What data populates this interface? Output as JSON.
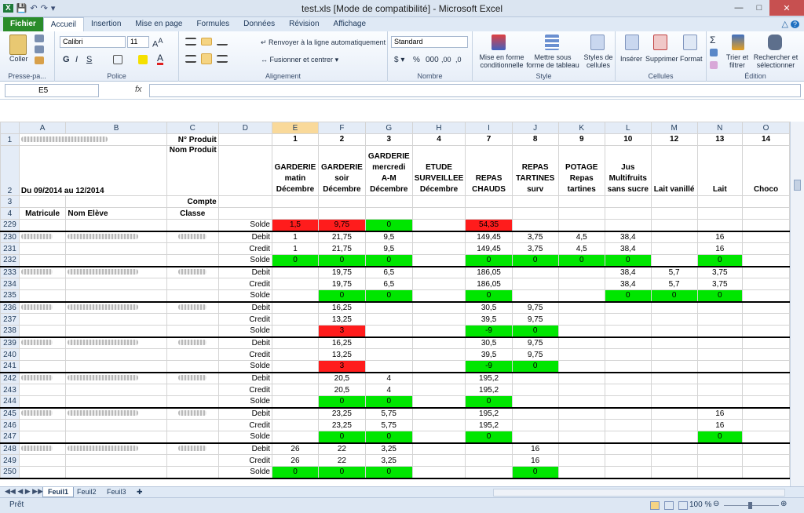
{
  "window": {
    "title": "test.xls  [Mode de compatibilité]  -  Microsoft Excel"
  },
  "tabs": [
    "Fichier",
    "Accueil",
    "Insertion",
    "Mise en page",
    "Formules",
    "Données",
    "Révision",
    "Affichage"
  ],
  "ribbon": {
    "clipboard": {
      "label": "Presse-pa...",
      "paste": "Coller"
    },
    "font": {
      "label": "Police",
      "name": "Calibri",
      "size": "11"
    },
    "alignment": {
      "label": "Alignement",
      "wrap": "Renvoyer à la ligne automatiquement",
      "merge": "Fusionner et centrer"
    },
    "number": {
      "label": "Nombre",
      "format": "Standard"
    },
    "style": {
      "label": "Style",
      "cond": "Mise en forme conditionnelle",
      "table": "Mettre sous forme de tableau",
      "cell": "Styles de cellules"
    },
    "cells": {
      "label": "Cellules",
      "insert": "Insérer",
      "delete": "Supprimer",
      "format": "Format"
    },
    "edit": {
      "label": "Édition",
      "sort": "Trier et filtrer",
      "find": "Rechercher et sélectionner"
    }
  },
  "formula_bar": {
    "name_box": "E5",
    "fx": "fx"
  },
  "columns": [
    "A",
    "B",
    "C",
    "D",
    "E",
    "F",
    "G",
    "H",
    "I",
    "J",
    "K",
    "L",
    "M",
    "N",
    "O"
  ],
  "header_rows": {
    "r1": {
      "c": "N° Produit",
      "nums": [
        "1",
        "2",
        "3",
        "4",
        "7",
        "8",
        "9",
        "10",
        "12",
        "13",
        "14"
      ]
    },
    "r2": {
      "a": "Du 09/2014 au 12/2014",
      "c": "Nom Produit",
      "products": [
        "GARDERIE matin Décembre",
        "GARDERIE soir Décembre",
        "GARDERIE mercredi A-M Décembre",
        "ETUDE SURVEILLEE Décembre",
        "REPAS CHAUDS",
        "REPAS TARTINES surv",
        "POTAGE Repas tartines",
        "Jus Multifruits sans sucre",
        "Lait vanillé",
        "Lait",
        "Choco"
      ]
    },
    "r3": {
      "c": "Compte"
    },
    "r4": {
      "a": "Matricule",
      "b": "Nom Elève",
      "c": "Classe"
    }
  },
  "rows": [
    {
      "n": "229",
      "d": "Solde",
      "v": [
        "1,5",
        "9,75",
        "0",
        "",
        "54,35",
        "",
        "",
        "",
        "",
        "",
        ""
      ],
      "cl": [
        "r",
        "r",
        "g",
        "",
        "r",
        "",
        "",
        "",
        "",
        "",
        ""
      ]
    },
    {
      "n": "230",
      "d": "Debit",
      "v": [
        "1",
        "21,75",
        "9,5",
        "",
        "149,45",
        "3,75",
        "4,5",
        "38,4",
        "",
        "16",
        ""
      ]
    },
    {
      "n": "231",
      "d": "Credit",
      "v": [
        "1",
        "21,75",
        "9,5",
        "",
        "149,45",
        "3,75",
        "4,5",
        "38,4",
        "",
        "16",
        ""
      ]
    },
    {
      "n": "232",
      "d": "Solde",
      "v": [
        "0",
        "0",
        "0",
        "",
        "0",
        "0",
        "0",
        "0",
        "",
        "0",
        ""
      ],
      "cl": [
        "g",
        "g",
        "g",
        "",
        "g",
        "g",
        "g",
        "g",
        "",
        "g",
        ""
      ]
    },
    {
      "n": "233",
      "d": "Debit",
      "v": [
        "",
        "19,75",
        "6,5",
        "",
        "186,05",
        "",
        "",
        "38,4",
        "5,7",
        "3,75",
        ""
      ]
    },
    {
      "n": "234",
      "d": "Credit",
      "v": [
        "",
        "19,75",
        "6,5",
        "",
        "186,05",
        "",
        "",
        "38,4",
        "5,7",
        "3,75",
        ""
      ]
    },
    {
      "n": "235",
      "d": "Solde",
      "v": [
        "",
        "0",
        "0",
        "",
        "0",
        "",
        "",
        "0",
        "0",
        "0",
        ""
      ],
      "cl": [
        "",
        "g",
        "g",
        "",
        "g",
        "",
        "",
        "g",
        "g",
        "g",
        ""
      ]
    },
    {
      "n": "236",
      "d": "Debit",
      "v": [
        "",
        "16,25",
        "",
        "",
        "30,5",
        "9,75",
        "",
        "",
        "",
        "",
        ""
      ]
    },
    {
      "n": "237",
      "d": "Credit",
      "v": [
        "",
        "13,25",
        "",
        "",
        "39,5",
        "9,75",
        "",
        "",
        "",
        "",
        ""
      ]
    },
    {
      "n": "238",
      "d": "Solde",
      "v": [
        "",
        "3",
        "",
        "",
        "-9",
        "0",
        "",
        "",
        "",
        "",
        ""
      ],
      "cl": [
        "",
        "r",
        "",
        "",
        "g",
        "g",
        "",
        "",
        "",
        "",
        ""
      ]
    },
    {
      "n": "239",
      "d": "Debit",
      "v": [
        "",
        "16,25",
        "",
        "",
        "30,5",
        "9,75",
        "",
        "",
        "",
        "",
        ""
      ]
    },
    {
      "n": "240",
      "d": "Credit",
      "v": [
        "",
        "13,25",
        "",
        "",
        "39,5",
        "9,75",
        "",
        "",
        "",
        "",
        ""
      ]
    },
    {
      "n": "241",
      "d": "Solde",
      "v": [
        "",
        "3",
        "",
        "",
        "-9",
        "0",
        "",
        "",
        "",
        "",
        ""
      ],
      "cl": [
        "",
        "r",
        "",
        "",
        "g",
        "g",
        "",
        "",
        "",
        "",
        ""
      ]
    },
    {
      "n": "242",
      "d": "Debit",
      "v": [
        "",
        "20,5",
        "4",
        "",
        "195,2",
        "",
        "",
        "",
        "",
        "",
        ""
      ]
    },
    {
      "n": "243",
      "d": "Credit",
      "v": [
        "",
        "20,5",
        "4",
        "",
        "195,2",
        "",
        "",
        "",
        "",
        "",
        ""
      ]
    },
    {
      "n": "244",
      "d": "Solde",
      "v": [
        "",
        "0",
        "0",
        "",
        "0",
        "",
        "",
        "",
        "",
        "",
        ""
      ],
      "cl": [
        "",
        "g",
        "g",
        "",
        "g",
        "",
        "",
        "",
        "",
        "",
        ""
      ]
    },
    {
      "n": "245",
      "d": "Debit",
      "v": [
        "",
        "23,25",
        "5,75",
        "",
        "195,2",
        "",
        "",
        "",
        "",
        "16",
        ""
      ]
    },
    {
      "n": "246",
      "d": "Credit",
      "v": [
        "",
        "23,25",
        "5,75",
        "",
        "195,2",
        "",
        "",
        "",
        "",
        "16",
        ""
      ]
    },
    {
      "n": "247",
      "d": "Solde",
      "v": [
        "",
        "0",
        "0",
        "",
        "0",
        "",
        "",
        "",
        "",
        "0",
        ""
      ],
      "cl": [
        "",
        "g",
        "g",
        "",
        "g",
        "",
        "",
        "",
        "",
        "g",
        ""
      ]
    },
    {
      "n": "248",
      "d": "Debit",
      "v": [
        "26",
        "22",
        "3,25",
        "",
        "",
        "16",
        "",
        "",
        "",
        "",
        ""
      ]
    },
    {
      "n": "249",
      "d": "Credit",
      "v": [
        "26",
        "22",
        "3,25",
        "",
        "",
        "16",
        "",
        "",
        "",
        "",
        ""
      ]
    },
    {
      "n": "250",
      "d": "Solde",
      "v": [
        "0",
        "0",
        "0",
        "",
        "",
        "0",
        "",
        "",
        "",
        "",
        ""
      ],
      "cl": [
        "g",
        "g",
        "g",
        "",
        "",
        "g",
        "",
        "",
        "",
        "",
        ""
      ]
    }
  ],
  "sheets": [
    "Feuil1",
    "Feuil2",
    "Feuil3"
  ],
  "status": {
    "ready": "Prêt",
    "zoom": "100 %"
  }
}
